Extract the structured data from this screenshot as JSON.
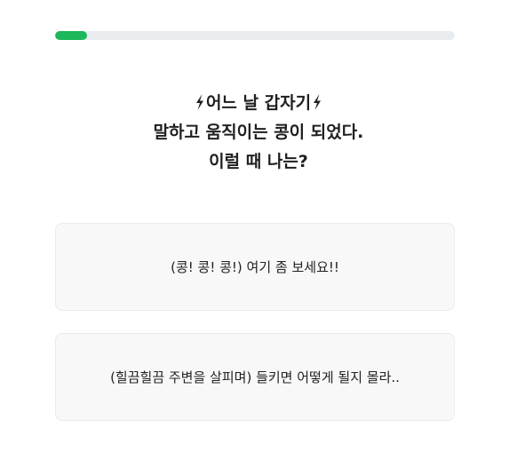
{
  "progress": {
    "fraction": 0.08,
    "color": "#1cb85b"
  },
  "question": {
    "line1_text": "어느 날 갑자기",
    "line1_icon": "lightning-bolt-icon",
    "line2": "말하고 움직이는 콩이 되었다.",
    "line3": "이럴 때 나는?"
  },
  "answers": [
    {
      "label": "(콩! 콩! 콩!) 여기 좀 보세요!!"
    },
    {
      "label": "(힐끔힐끔 주변을 살피며) 들키면 어떻게 될지 몰라.."
    }
  ]
}
